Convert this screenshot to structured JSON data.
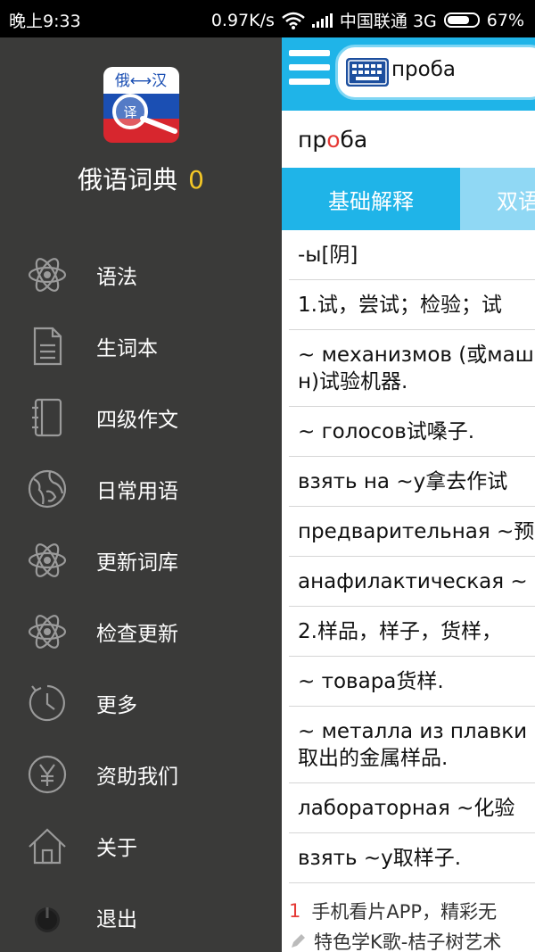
{
  "status_bar": {
    "time": "晚上9:33",
    "speed": "0.97K/s",
    "carrier": "中国联通 3G",
    "battery": "67%"
  },
  "drawer": {
    "app_name": "俄语词典",
    "count": "0",
    "logo_text_top": "俄⟷汉",
    "logo_text_mid": "译",
    "items": [
      {
        "label": "语法",
        "icon": "atom-icon"
      },
      {
        "label": "生词本",
        "icon": "document-icon"
      },
      {
        "label": "四级作文",
        "icon": "notebook-icon"
      },
      {
        "label": "日常用语",
        "icon": "globe-icon"
      },
      {
        "label": "更新词库",
        "icon": "atom-icon"
      },
      {
        "label": "检查更新",
        "icon": "atom-icon"
      },
      {
        "label": "更多",
        "icon": "clock-icon"
      },
      {
        "label": "资助我们",
        "icon": "yen-icon"
      },
      {
        "label": "关于",
        "icon": "home-icon"
      },
      {
        "label": "退出",
        "icon": "power-icon"
      }
    ]
  },
  "main": {
    "search_value": "проба",
    "word": {
      "pre": "пр",
      "stress": "о",
      "post": "ба"
    },
    "tabs": [
      "基础解释",
      "双语"
    ],
    "entries": [
      "-ы[阴]",
      "1.试，尝试；检验；试",
      "~ механизмов (或машин)试验机器.",
      "~ голосов试嗓子.",
      "взять на ~у拿去作试",
      "предварительная ~预",
      "анафилактическая ~",
      "2.样品，样子，货样，",
      "~ товара货样.",
      "~ металла из плавки 取出的金属样品.",
      "лабораторная ~化验",
      "взять ~у取样子."
    ],
    "ads": [
      {
        "num": "1",
        "text": "手机看片APP，精彩无"
      },
      {
        "num": "",
        "text": "特色学K歌-桔子树艺术"
      }
    ]
  }
}
